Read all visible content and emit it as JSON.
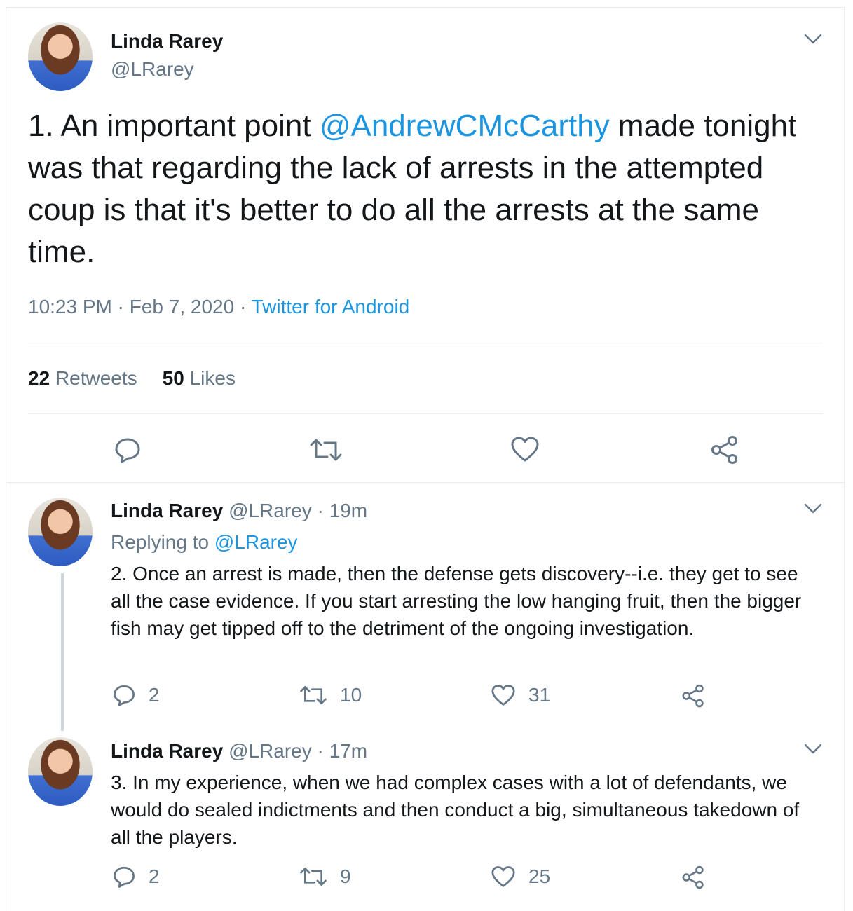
{
  "main_tweet": {
    "author_name": "Linda Rarey",
    "handle": "@LRarey",
    "text_before": "1. An important point ",
    "mention": "@AndrewCMcCarthy",
    "text_after": "  made tonight was that regarding the lack of arrests in the attempted coup is that it's better to do all the arrests at the same time.",
    "time": "10:23 PM",
    "sep1": " · ",
    "date": "Feb 7, 2020",
    "sep2": " · ",
    "source": "Twitter for Android",
    "retweets_count": "22",
    "retweets_label": "Retweets",
    "likes_count": "50",
    "likes_label": "Likes"
  },
  "replies": [
    {
      "author_name": "Linda Rarey",
      "handle": "@LRarey",
      "dot": " · ",
      "age": "19m",
      "replying_label": "Replying to ",
      "replying_to": "@LRarey",
      "text": "2. Once an arrest is made, then the defense gets discovery--i.e. they get to see all the case evidence. If you start arresting the low hanging fruit, then the bigger fish may get tipped off to the detriment of the ongoing investigation.",
      "reply_count": "2",
      "retweet_count": "10",
      "like_count": "31"
    },
    {
      "author_name": "Linda Rarey",
      "handle": "@LRarey",
      "dot": " · ",
      "age": "17m",
      "text": "3. In my experience, when we had complex cases with a lot of defendants, we would do sealed indictments and then conduct a big, simultaneous takedown of all the players.",
      "reply_count": "2",
      "retweet_count": "9",
      "like_count": "25"
    }
  ],
  "colors": {
    "link": "#1b95e0",
    "secondary": "#657786",
    "text": "#14171a",
    "border": "#e6ecf0"
  },
  "icons": [
    "chevron-down-icon",
    "reply-icon",
    "retweet-icon",
    "like-icon",
    "share-icon"
  ]
}
